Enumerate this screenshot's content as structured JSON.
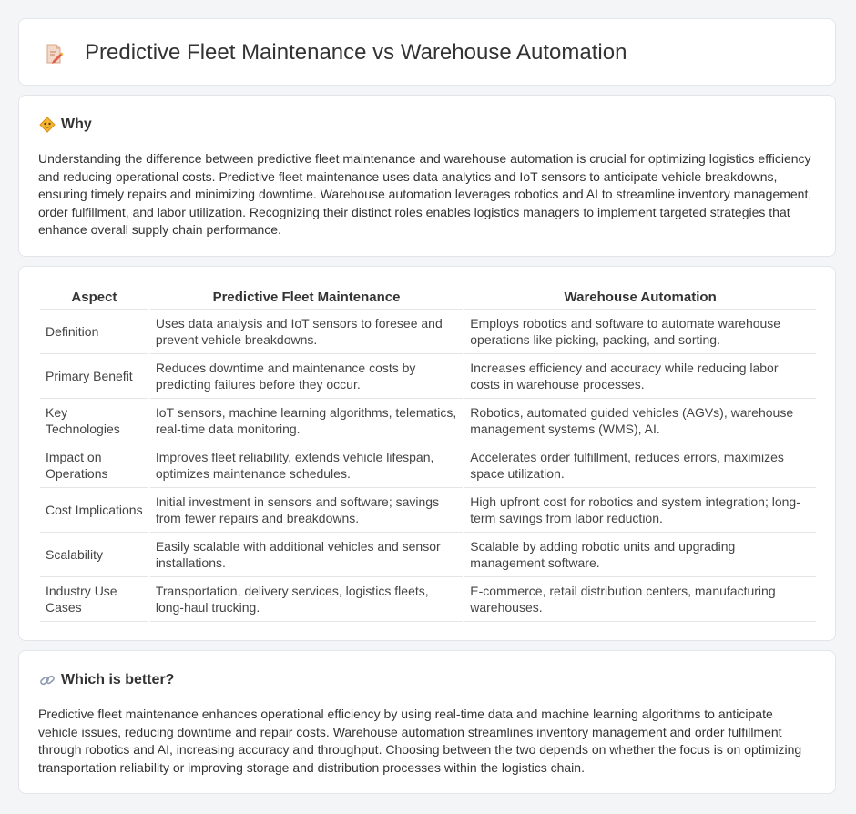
{
  "page": {
    "title": "Predictive Fleet Maintenance vs Warehouse Automation"
  },
  "why": {
    "heading": "Why",
    "body": "Understanding the difference between predictive fleet maintenance and warehouse automation is crucial for optimizing logistics efficiency and reducing operational costs. Predictive fleet maintenance uses data analytics and IoT sensors to anticipate vehicle breakdowns, ensuring timely repairs and minimizing downtime. Warehouse automation leverages robotics and AI to streamline inventory management, order fulfillment, and labor utilization. Recognizing their distinct roles enables logistics managers to implement targeted strategies that enhance overall supply chain performance."
  },
  "table": {
    "headers": [
      "Aspect",
      "Predictive Fleet Maintenance",
      "Warehouse Automation"
    ],
    "rows": [
      [
        "Definition",
        "Uses data analysis and IoT sensors to foresee and prevent vehicle breakdowns.",
        "Employs robotics and software to automate warehouse operations like picking, packing, and sorting."
      ],
      [
        "Primary Benefit",
        "Reduces downtime and maintenance costs by predicting failures before they occur.",
        "Increases efficiency and accuracy while reducing labor costs in warehouse processes."
      ],
      [
        "Key Technologies",
        "IoT sensors, machine learning algorithms, telematics, real-time data monitoring.",
        "Robotics, automated guided vehicles (AGVs), warehouse management systems (WMS), AI."
      ],
      [
        "Impact on Operations",
        "Improves fleet reliability, extends vehicle lifespan, optimizes maintenance schedules.",
        "Accelerates order fulfillment, reduces errors, maximizes space utilization."
      ],
      [
        "Cost Implications",
        "Initial investment in sensors and software; savings from fewer repairs and breakdowns.",
        "High upfront cost for robotics and system integration; long-term savings from labor reduction."
      ],
      [
        "Scalability",
        "Easily scalable with additional vehicles and sensor installations.",
        "Scalable by adding robotic units and upgrading management software."
      ],
      [
        "Industry Use Cases",
        "Transportation, delivery services, logistics fleets, long-haul trucking.",
        "E-commerce, retail distribution centers, manufacturing warehouses."
      ]
    ]
  },
  "better": {
    "heading": "Which is better?",
    "body": "Predictive fleet maintenance enhances operational efficiency by using real-time data and machine learning algorithms to anticipate vehicle issues, reducing downtime and repair costs. Warehouse automation streamlines inventory management and order fulfillment through robotics and AI, increasing accuracy and throughput. Choosing between the two depends on whether the focus is on optimizing transportation reliability or improving storage and distribution processes within the logistics chain."
  }
}
